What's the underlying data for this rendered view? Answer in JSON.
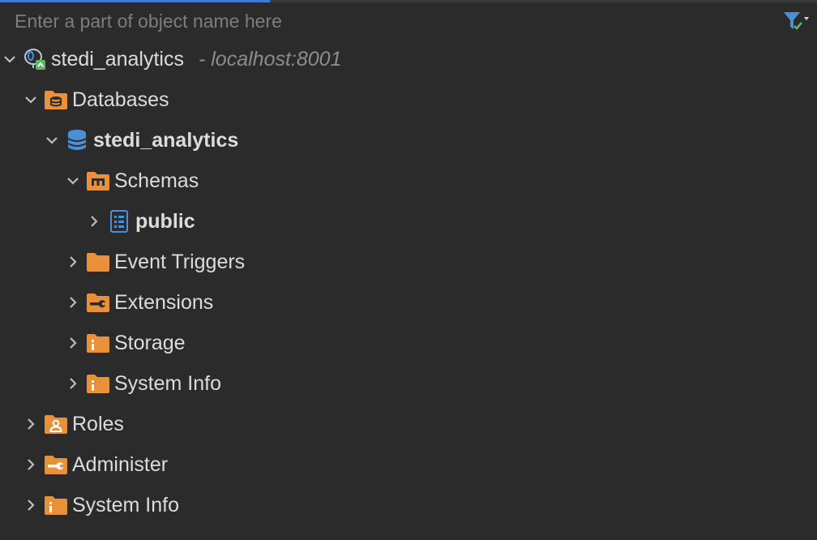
{
  "progress": {
    "fraction": 0.33,
    "color": "#3d7bd6"
  },
  "search": {
    "placeholder": "Enter a part of object name here",
    "value": ""
  },
  "toolbar": {
    "filter_icon": "filter-check-icon"
  },
  "colors": {
    "folder": "#e8913a",
    "db": "#4a8fd8",
    "background": "#2b2b2b"
  },
  "tree": {
    "connection": {
      "label": "stedi_analytics",
      "host": "- localhost:8001"
    },
    "databases": {
      "label": "Databases"
    },
    "database": {
      "label": "stedi_analytics"
    },
    "schemas": {
      "label": "Schemas"
    },
    "public": {
      "label": "public"
    },
    "event_triggers": {
      "label": "Event Triggers"
    },
    "extensions": {
      "label": "Extensions"
    },
    "storage": {
      "label": "Storage"
    },
    "db_system_info": {
      "label": "System Info"
    },
    "roles": {
      "label": "Roles"
    },
    "administer": {
      "label": "Administer"
    },
    "system_info": {
      "label": "System Info"
    }
  }
}
